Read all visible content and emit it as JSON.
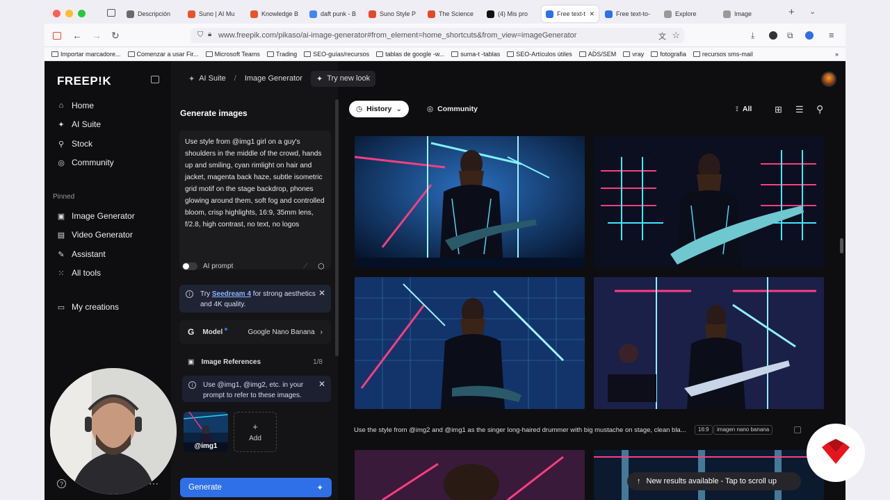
{
  "browser": {
    "tabs": [
      {
        "label": "Descripción",
        "color": "#6a6a6a"
      },
      {
        "label": "Suno | AI Mu",
        "color": "#e8542b"
      },
      {
        "label": "Knowledge B",
        "color": "#e8542b"
      },
      {
        "label": "daft punk - B",
        "color": "#4285f4"
      },
      {
        "label": "Suno Style P",
        "color": "#e24a2b"
      },
      {
        "label": "The Science",
        "color": "#e24a2b"
      },
      {
        "label": "(4) Mis pro",
        "color": "#111111"
      },
      {
        "label": "Free text-t",
        "color": "#2f6fe8"
      },
      {
        "label": "Free text-to-",
        "color": "#2f6fe8"
      },
      {
        "label": "Explore",
        "color": "#999999"
      },
      {
        "label": "Image",
        "color": "#999999"
      }
    ],
    "url": "www.freepik.com/pikaso/ai-image-generator#from_element=home_shortcuts&from_view=imageGenerator",
    "bookmarks": [
      "Importar marcadore...",
      "Comenzar a usar Fir...",
      "Microsoft Teams",
      "Trading",
      "SEO-guías/recursos",
      "tablas de google -w...",
      "suma-t -tablas",
      "SEO-Artículos útiles",
      "ADS/SEM",
      "vray",
      "fotografia",
      "recursos sms-mail"
    ]
  },
  "sidebar": {
    "logo": "FREEP!K",
    "nav": [
      "Home",
      "AI Suite",
      "Stock",
      "Community"
    ],
    "pinned_label": "Pinned",
    "pinned": [
      "Image Generator",
      "Video Generator",
      "Assistant",
      "All tools"
    ],
    "my_creations": "My creations"
  },
  "breadcrumb": {
    "ai_suite": "AI Suite",
    "sep": "/",
    "image_generator": "Image Generator",
    "try_new": "Try new look"
  },
  "panel": {
    "title": "Generate images",
    "prompt": "Use style from @img1 girl on a guy's shoulders in the middle of the crowd, hands up and smiling, cyan rimlight on hair and jacket, magenta back haze, subtle isometric grid motif on the stage backdrop, phones glowing around them, soft fog and controlled bloom, crisp highlights, 16:9, 35mm lens, f/2.8, high contrast, no text, no logos",
    "ai_prompt": "AI prompt",
    "seedream_prefix": "Try ",
    "seedream_link": "Seedream 4",
    "seedream_suffix": " for strong aesthetics and 4K quality.",
    "model_label": "Model",
    "model_value": "Google Nano Banana",
    "refs_label": "Image References",
    "refs_count": "1/8",
    "refs_hint": "Use @img1, @img2, etc. in your prompt to refer to these images.",
    "ref_tag": "@img1",
    "add_label": "Add",
    "add_plus": "+",
    "generate": "Generate"
  },
  "main": {
    "history": "History",
    "community": "Community",
    "filter_all": "All",
    "caption": "Use the style from @img2 and @img1 as the singer long-haired drummer with big mustache on stage, clean bla...",
    "tag_ratio": "16:9",
    "tag_model": "imagen nano banana",
    "toast": "New results available - Tap to scroll up"
  },
  "colors": {
    "accent": "#2f6fe8",
    "cyan": "#28d6f0",
    "magenta": "#ff2f86"
  }
}
